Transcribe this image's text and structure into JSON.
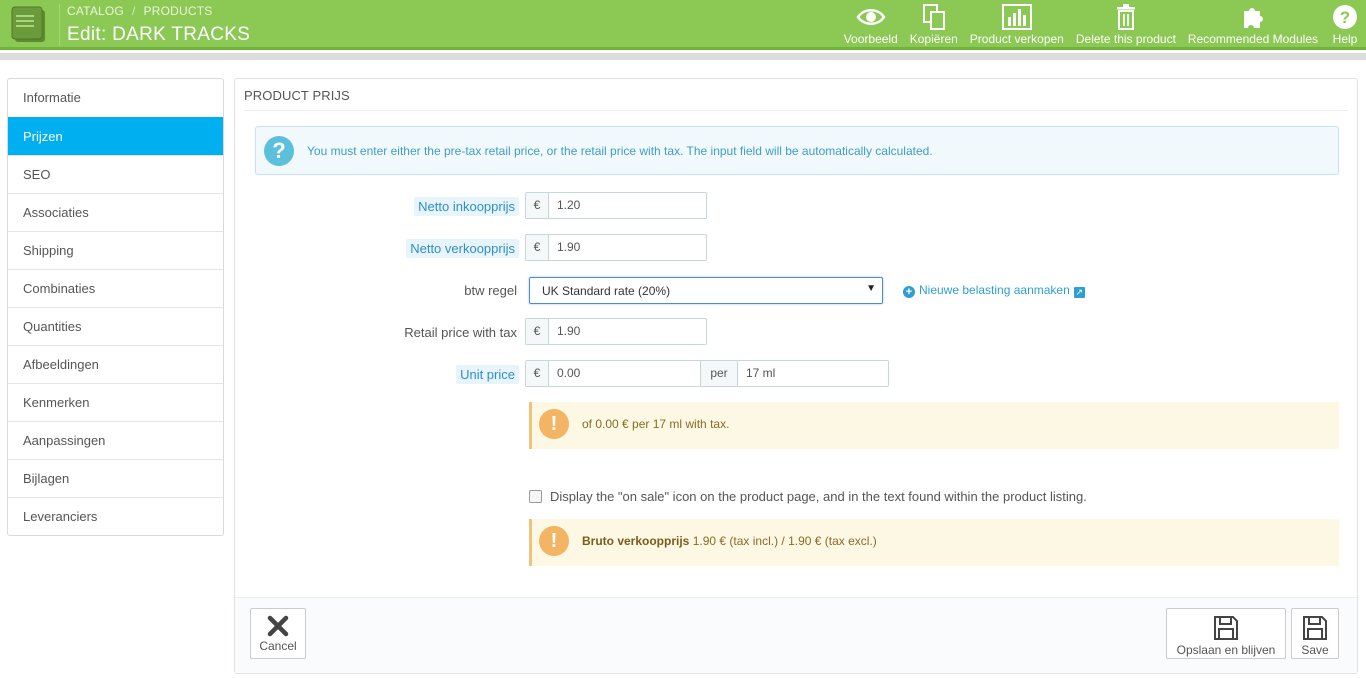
{
  "header": {
    "breadcrumb": [
      "CATALOG",
      "PRODUCTS"
    ],
    "breadcrumb_sep": "/",
    "title": "Edit: DARK TRACKS",
    "toolbar": [
      {
        "id": "preview",
        "label": "Voorbeeld",
        "icon": "eye-icon"
      },
      {
        "id": "duplicate",
        "label": "Kopiëren",
        "icon": "copy-icon"
      },
      {
        "id": "sales",
        "label": "Product verkopen",
        "icon": "bar-chart-icon"
      },
      {
        "id": "delete",
        "label": "Delete this product",
        "icon": "trash-icon"
      },
      {
        "id": "modules",
        "label": "Recommended Modules",
        "icon": "puzzle-icon"
      },
      {
        "id": "help",
        "label": "Help",
        "icon": "help-icon"
      }
    ]
  },
  "sidebar": {
    "items": [
      {
        "label": "Informatie",
        "active": false
      },
      {
        "label": "Prijzen",
        "active": true
      },
      {
        "label": "SEO",
        "active": false
      },
      {
        "label": "Associaties",
        "active": false
      },
      {
        "label": "Shipping",
        "active": false
      },
      {
        "label": "Combinaties",
        "active": false
      },
      {
        "label": "Quantities",
        "active": false
      },
      {
        "label": "Afbeeldingen",
        "active": false
      },
      {
        "label": "Kenmerken",
        "active": false
      },
      {
        "label": "Aanpassingen",
        "active": false
      },
      {
        "label": "Bijlagen",
        "active": false
      },
      {
        "label": "Leveranciers",
        "active": false
      }
    ]
  },
  "panel": {
    "heading": "PRODUCT PRIJS",
    "info_alert": "You must enter either the pre-tax retail price, or the retail price with tax. The input field will be automatically calculated.",
    "currency": "€",
    "wholesale": {
      "label": "Netto inkoopprijs",
      "value": "1.20"
    },
    "retail": {
      "label": "Netto verkoopprijs",
      "value": "1.90"
    },
    "tax_rule": {
      "label": "btw regel",
      "value": "UK Standard rate (20%)",
      "new_link": "Nieuwe belasting aanmaken"
    },
    "retail_with_tax": {
      "label": "Retail price with tax",
      "value": "1.90"
    },
    "unit_price": {
      "label": "Unit price",
      "value": "0.00",
      "per": "per",
      "unity": "17 ml"
    },
    "unit_warning": "of 0.00 € per 17 ml with tax.",
    "on_sale_label": "Display the \"on sale\" icon on the product page, and in the text found within the product listing.",
    "on_sale_checked": false,
    "final_price": {
      "label": "Bruto verkoopprijs",
      "text": "1.90 € (tax incl.) / 1.90 € (tax excl.)"
    }
  },
  "footer": {
    "cancel": "Cancel",
    "save_stay": "Opslaan en blijven",
    "save": "Save"
  },
  "colors": {
    "header_bg": "#8bc954",
    "active_tab": "#00aff0",
    "link": "#2f9fd1",
    "warning_icon": "#f3b463"
  }
}
